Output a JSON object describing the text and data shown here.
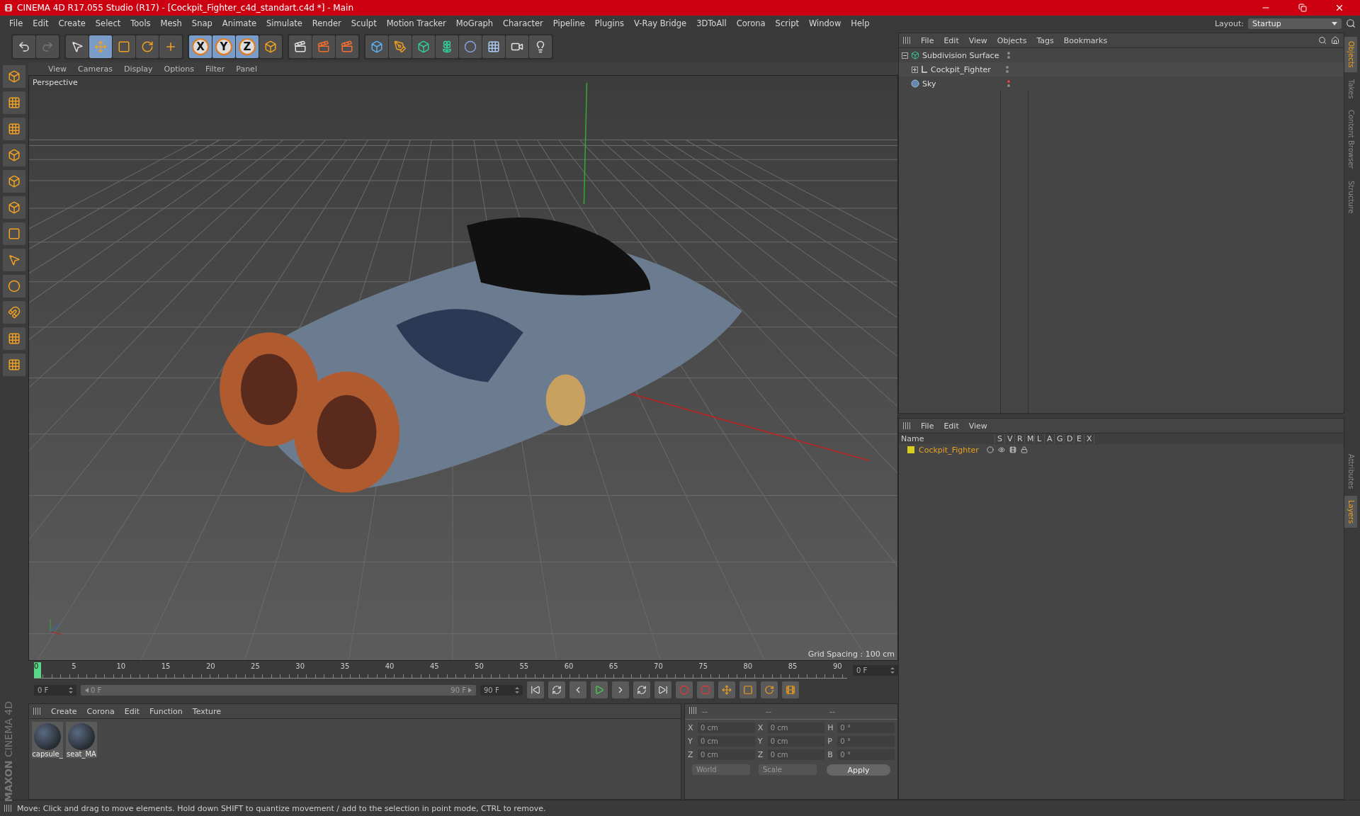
{
  "window": {
    "title": "CINEMA 4D R17.055 Studio (R17) - [Cockpit_Fighter_c4d_standart.c4d *] - Main"
  },
  "menu": [
    "File",
    "Edit",
    "Create",
    "Select",
    "Tools",
    "Mesh",
    "Snap",
    "Animate",
    "Simulate",
    "Render",
    "Sculpt",
    "Motion Tracker",
    "MoGraph",
    "Character",
    "Pipeline",
    "Plugins",
    "V-Ray Bridge",
    "3DToAll",
    "Corona",
    "Script",
    "Window",
    "Help"
  ],
  "layout": {
    "label": "Layout:",
    "value": "Startup"
  },
  "toolbar": {
    "axis_buttons": [
      "X",
      "Y",
      "Z"
    ]
  },
  "viewport": {
    "menu": [
      "View",
      "Cameras",
      "Display",
      "Options",
      "Filter",
      "Panel"
    ],
    "label": "Perspective",
    "grid_spacing": "Grid Spacing : 100 cm"
  },
  "timeline": {
    "ticks": [
      "0",
      "5",
      "10",
      "15",
      "20",
      "25",
      "30",
      "35",
      "40",
      "45",
      "50",
      "55",
      "60",
      "65",
      "70",
      "75",
      "80",
      "85",
      "90"
    ],
    "frame": "0 F",
    "start": "0 F",
    "range": {
      "start": "0 F",
      "end": "90 F",
      "level": 1
    },
    "end": "90 F"
  },
  "materials": {
    "menu": [
      "Create",
      "Corona",
      "Edit",
      "Function",
      "Texture"
    ],
    "items": [
      {
        "name": "capsule_"
      },
      {
        "name": "seat_MA"
      }
    ]
  },
  "branding": {
    "maker": "MAXON",
    "product": "CINEMA 4D"
  },
  "coordinates": {
    "headers": [
      "--",
      "--",
      "--"
    ],
    "rows": [
      [
        {
          "axis": "X",
          "value": "0 cm"
        },
        {
          "axis": "X",
          "value": "0 cm"
        },
        {
          "axis": "H",
          "value": "0 °"
        }
      ],
      [
        {
          "axis": "Y",
          "value": "0 cm"
        },
        {
          "axis": "Y",
          "value": "0 cm"
        },
        {
          "axis": "P",
          "value": "0 °"
        }
      ],
      [
        {
          "axis": "Z",
          "value": "0 cm"
        },
        {
          "axis": "Z",
          "value": "0 cm"
        },
        {
          "axis": "B",
          "value": "0 °"
        }
      ]
    ],
    "space": "World",
    "mode": "Scale",
    "apply": "Apply"
  },
  "objects": {
    "menu": [
      "File",
      "Edit",
      "View",
      "Objects",
      "Tags",
      "Bookmarks"
    ],
    "items": [
      {
        "name": "Subdivision Surface",
        "kind": "subdivision",
        "expanded": true,
        "render_off": false,
        "children": [
          {
            "name": "Cockpit_Fighter",
            "kind": "null",
            "expanded": false,
            "render_off": false
          }
        ]
      },
      {
        "name": "Sky",
        "kind": "sky",
        "render_off": true
      }
    ]
  },
  "layers": {
    "menu": [
      "File",
      "Edit",
      "View"
    ],
    "columns": [
      "Name",
      "S",
      "V",
      "R",
      "M",
      "L",
      "A",
      "G",
      "D",
      "E",
      "X"
    ],
    "rows": [
      {
        "name": "Cockpit_Fighter",
        "color": "#d8cf1c"
      }
    ]
  },
  "side_tabs_top": [
    {
      "label": "Objects",
      "selected": true
    },
    {
      "label": "Takes",
      "selected": false
    },
    {
      "label": "Content Browser",
      "selected": false
    },
    {
      "label": "Structure",
      "selected": false
    }
  ],
  "side_tabs_bottom": [
    {
      "label": "Attributes",
      "selected": false
    },
    {
      "label": "Layers",
      "selected": true
    }
  ],
  "status": "Move: Click and drag to move elements. Hold down SHIFT to quantize movement / add to the selection in point mode, CTRL to remove."
}
